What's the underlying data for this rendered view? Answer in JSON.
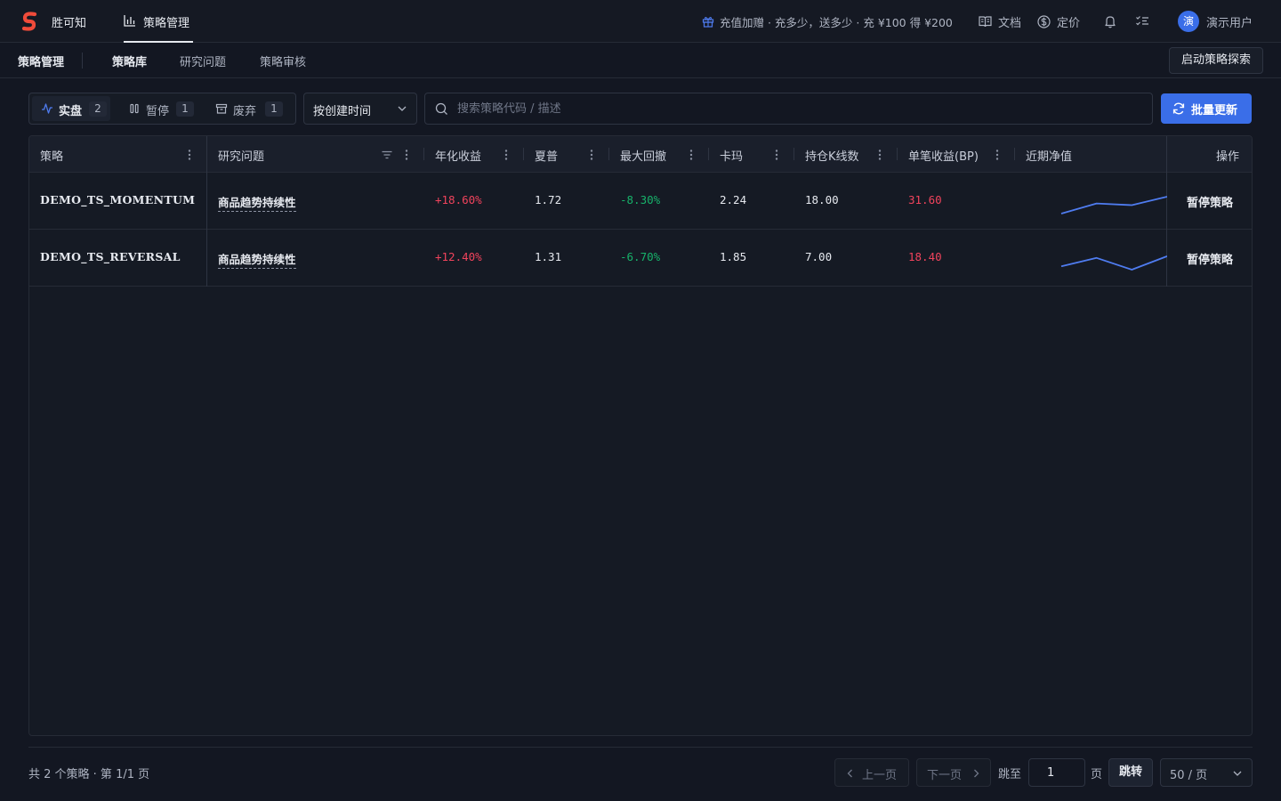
{
  "colors": {
    "accent": "#3a6ee8",
    "positive": "#f0435c",
    "negative": "#17b26a",
    "sparkline": "#4f7cf0",
    "logo": "#ef4b3a"
  },
  "header": {
    "brand": "胜可知",
    "nav_active": "策略管理",
    "promo": "充值加赠 · 充多少，送多少 · 充 ¥100 得 ¥200",
    "docs": "文档",
    "pricing": "定价",
    "avatar_char": "演",
    "user_name": "演示用户"
  },
  "subnav": {
    "title": "策略管理",
    "tabs": [
      "策略库",
      "研究问题",
      "策略审核"
    ],
    "active_tab": "策略库",
    "launch_button": "启动策略探索"
  },
  "filters": {
    "segments": [
      {
        "label": "实盘",
        "count": "2",
        "active": true,
        "icon": "activity-icon"
      },
      {
        "label": "暂停",
        "count": "1",
        "active": false,
        "icon": "pause-icon"
      },
      {
        "label": "废弃",
        "count": "1",
        "active": false,
        "icon": "archive-icon"
      }
    ],
    "sort_label": "按创建时间",
    "search_placeholder": "搜索策略代码 / 描述",
    "batch_button": "批量更新"
  },
  "table": {
    "columns": [
      "策略",
      "研究问题",
      "年化收益",
      "夏普",
      "最大回撤",
      "卡玛",
      "持仓K线数",
      "单笔收益(BP)",
      "近期净值",
      "操作"
    ],
    "rows": [
      {
        "strategy": "DEMO_TS_MOMENTUM",
        "question": "商品趋势持续性",
        "annual_return": "+18.60%",
        "sharpe": "1.72",
        "max_drawdown": "-8.30%",
        "calmar": "2.24",
        "holding_bars": "18.00",
        "per_trade_bp": "31.60",
        "nav_trend": [
          0.0,
          0.6,
          0.5,
          1.0
        ],
        "action": "暂停策略"
      },
      {
        "strategy": "DEMO_TS_REVERSAL",
        "question": "商品趋势持续性",
        "annual_return": "+12.40%",
        "sharpe": "1.31",
        "max_drawdown": "-6.70%",
        "calmar": "1.85",
        "holding_bars": "7.00",
        "per_trade_bp": "18.40",
        "nav_trend": [
          0.25,
          0.75,
          0.05,
          0.85
        ],
        "action": "暂停策略"
      }
    ]
  },
  "pagination": {
    "summary": "共 2 个策略 · 第 1/1 页",
    "prev": "上一页",
    "next": "下一页",
    "jump_to": "跳至",
    "jump_value": "1",
    "page_unit": "页",
    "jump_button": "跳转",
    "page_size": "50 / 页"
  }
}
